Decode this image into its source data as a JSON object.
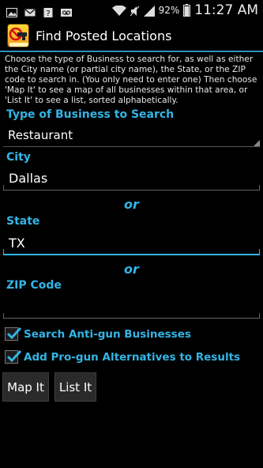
{
  "status_bar": {
    "icons": [
      "image-icon",
      "mail-icon",
      "unknown-file-icon",
      "voicemail-icon",
      "wifi-icon",
      "mute-icon",
      "signal-icon",
      "battery-icon"
    ],
    "battery": "92%",
    "time": "11:27 AM"
  },
  "app": {
    "title": "Find Posted Locations",
    "icon": "business-list-logo"
  },
  "instructions": "Choose the type of Business to search for, as well as either the City name (or partial city name), the State, or the ZIP code to search in.  (You only need to enter one)  Then choose 'Map It' to see a map of all businesses within that area, or 'List It' to see a list, sorted alphabetically.",
  "form": {
    "business_type_label": "Type of Business to Search",
    "business_type_value": "Restaurant",
    "city_label": "City",
    "city_value": "Dallas",
    "or_1": "or",
    "state_label": "State",
    "state_value": "TX",
    "or_2": "or",
    "zip_label": "ZIP Code",
    "zip_value": "",
    "checkbox_antigun": {
      "label": "Search Anti-gun Businesses",
      "checked": true
    },
    "checkbox_progun": {
      "label": "Add Pro-gun Alternatives to Results",
      "checked": true
    }
  },
  "buttons": {
    "map_it": "Map It",
    "list_it": "List It"
  },
  "colors": {
    "accent": "#33b5e5",
    "background": "#000000"
  }
}
